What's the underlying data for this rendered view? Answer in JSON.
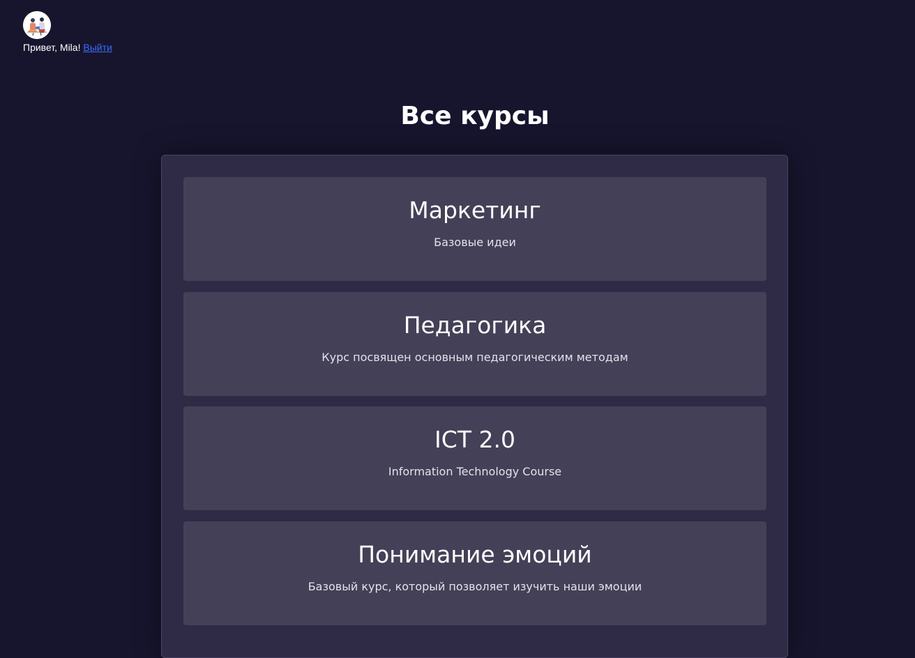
{
  "header": {
    "avatar_icon": "user-avatar-illustration",
    "greeting": "Привет, Mila!",
    "logout_label": "Выйти"
  },
  "page": {
    "title": "Все курсы"
  },
  "courses": [
    {
      "title": "Маркетинг",
      "description": "Базовые идеи"
    },
    {
      "title": "Педагогика",
      "description": "Курс посвящен основным педагогическим методам"
    },
    {
      "title": "ICT 2.0",
      "description": "Information Technology Course"
    },
    {
      "title": "Понимание эмоций",
      "description": "Базовый курс, который позволяет изучить наши эмоции"
    }
  ],
  "colors": {
    "background": "#17152e",
    "panel": "#2f2a45",
    "card": "#444057",
    "link": "#3a6cff"
  }
}
